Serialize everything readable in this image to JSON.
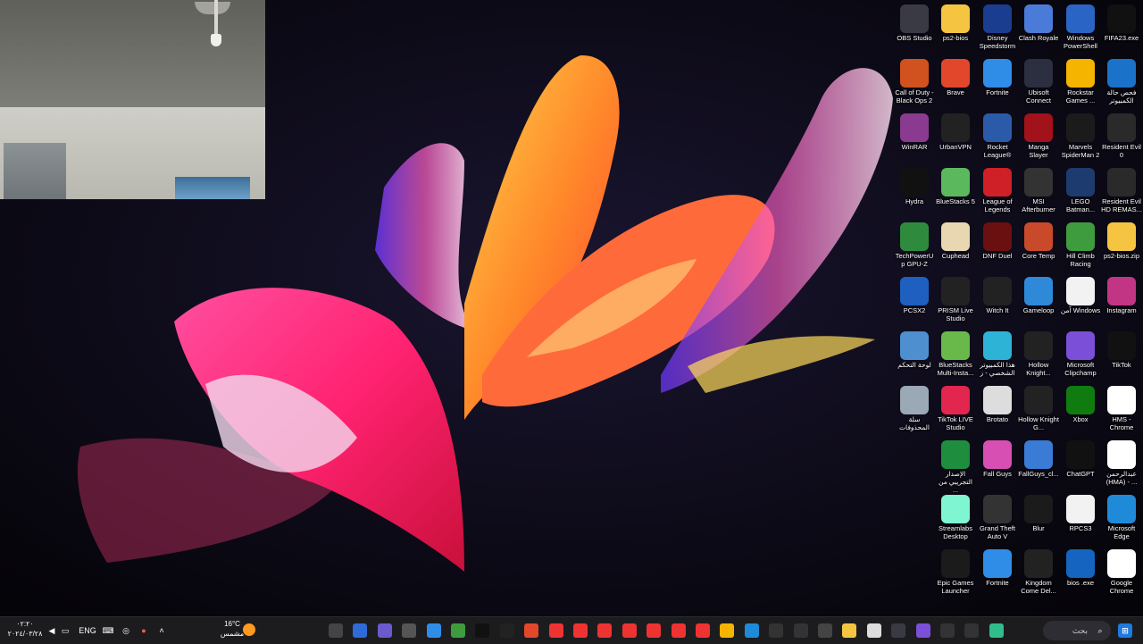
{
  "desktop_icons": [
    {
      "label": "OBS Studio",
      "icon": "obs-icon",
      "color": "#3a3a44"
    },
    {
      "label": "ps2-bios",
      "icon": "folder-icon",
      "color": "#f5c542"
    },
    {
      "label": "Disney Speedstorm",
      "icon": "disney-speedstorm-icon",
      "color": "#1b3d8f"
    },
    {
      "label": "Clash Royale",
      "icon": "clash-royale-icon",
      "color": "#4b7bd8"
    },
    {
      "label": "Windows PowerShell",
      "icon": "powershell-icon",
      "color": "#2a64c5"
    },
    {
      "label": "FIFA23.exe",
      "icon": "fifa-icon",
      "color": "#111111"
    },
    {
      "label": "Call of Duty - Black Ops 2",
      "icon": "cod-icon",
      "color": "#d1521f"
    },
    {
      "label": "Brave",
      "icon": "brave-icon",
      "color": "#e2472c"
    },
    {
      "label": "Fortnite",
      "icon": "fortnite-icon",
      "color": "#2f8de8"
    },
    {
      "label": "Ubisoft Connect",
      "icon": "ubisoft-icon",
      "color": "#2b2f3f"
    },
    {
      "label": "Rockstar Games ...",
      "icon": "rockstar-icon",
      "color": "#f4b400"
    },
    {
      "label": "فحص حالة الكمبيوتر",
      "icon": "pc-health-icon",
      "color": "#1a73c9"
    },
    {
      "label": "WinRAR",
      "icon": "winrar-icon",
      "color": "#8a3b8f"
    },
    {
      "label": "UrbanVPN",
      "icon": "urbanvpn-icon",
      "color": "#222"
    },
    {
      "label": "Rocket League®",
      "icon": "rocket-league-icon",
      "color": "#2b5ba8"
    },
    {
      "label": "Manga Slayer",
      "icon": "manga-slayer-icon",
      "color": "#a2121a"
    },
    {
      "label": "Marvels SpiderMan 2",
      "icon": "spiderman-icon",
      "color": "#1b1b1b"
    },
    {
      "label": "Resident Evil 0",
      "icon": "resident-evil-icon",
      "color": "#2a2a2a"
    },
    {
      "label": "Hydra",
      "icon": "hydra-icon",
      "color": "#111111"
    },
    {
      "label": "BlueStacks 5",
      "icon": "bluestacks-icon",
      "color": "#5cb85c"
    },
    {
      "label": "League of Legends",
      "icon": "lol-icon",
      "color": "#cf1f27"
    },
    {
      "label": "MSI Afterburner",
      "icon": "msi-afterburner-icon",
      "color": "#333"
    },
    {
      "label": "LEGO Batman...",
      "icon": "lego-batman-icon",
      "color": "#1d3b6e"
    },
    {
      "label": "Resident Evil HD REMAS...",
      "icon": "resident-evil-hd-icon",
      "color": "#2a2a2a"
    },
    {
      "label": "TechPowerUp GPU-Z",
      "icon": "gpuz-icon",
      "color": "#2e8b3e"
    },
    {
      "label": "Cuphead",
      "icon": "cuphead-icon",
      "color": "#e8d7b0"
    },
    {
      "label": "DNF Duel",
      "icon": "dnf-duel-icon",
      "color": "#6b1010"
    },
    {
      "label": "Core Temp",
      "icon": "core-temp-icon",
      "color": "#c84a2a"
    },
    {
      "label": "Hill Climb Racing",
      "icon": "hill-climb-icon",
      "color": "#3e9c3e"
    },
    {
      "label": "ps2-bios.zip",
      "icon": "zip-folder-icon",
      "color": "#f5c542"
    },
    {
      "label": "PCSX2",
      "icon": "pcsx2-icon",
      "color": "#1f5fbf"
    },
    {
      "label": "PRISM Live Studio",
      "icon": "prism-icon",
      "color": "#222"
    },
    {
      "label": "Witch It",
      "icon": "epic-games-icon",
      "color": "#222"
    },
    {
      "label": "Gameloop",
      "icon": "gameloop-icon",
      "color": "#2e8ad8"
    },
    {
      "label": "آمن Windows",
      "icon": "file-icon",
      "color": "#f2f2f2"
    },
    {
      "label": "Instagram",
      "icon": "instagram-icon",
      "color": "#c13584"
    },
    {
      "label": "لوحة التحكم",
      "icon": "control-panel-icon",
      "color": "#4e8fd0"
    },
    {
      "label": "BlueStacks Multi-Insta...",
      "icon": "bluestacks-multi-icon",
      "color": "#69b94a"
    },
    {
      "label": "هذا الكمبيوتر الشخصي - ز",
      "icon": "this-pc-icon",
      "color": "#2db3d6"
    },
    {
      "label": "Hollow Knight...",
      "icon": "hollow-knight-icon",
      "color": "#222"
    },
    {
      "label": "Microsoft Clipchamp",
      "icon": "clipchamp-icon",
      "color": "#7b4fd8"
    },
    {
      "label": "TikTok",
      "icon": "tiktok-icon",
      "color": "#111"
    },
    {
      "label": "سلة المحذوفات",
      "icon": "recycle-bin-icon",
      "color": "#9aa9b5"
    },
    {
      "label": "TikTok LIVE Studio",
      "icon": "tiktok-live-icon",
      "color": "#e2264d"
    },
    {
      "label": "Brotato",
      "icon": "brotato-icon",
      "color": "#dddddd"
    },
    {
      "label": "Hollow Knight G...",
      "icon": "hollow-knight-g-icon",
      "color": "#222"
    },
    {
      "label": "Xbox",
      "icon": "xbox-icon",
      "color": "#107c10"
    },
    {
      "label": "HMS - Chrome",
      "icon": "chrome-icon",
      "color": "#ffffff"
    },
    {
      "label": "الإصدار التجريبي من ...",
      "icon": "play-games-beta-icon",
      "color": "#1e8e3e"
    },
    {
      "label": "Fall Guys",
      "icon": "fall-guys-icon",
      "color": "#d84fb3"
    },
    {
      "label": "FallGuys_cl...",
      "icon": "fall-guys-client-icon",
      "color": "#3a7bd5"
    },
    {
      "label": "ChatGPT",
      "icon": "chatgpt-icon",
      "color": "#111"
    },
    {
      "label": "عبدالرحمن (HMA) - ...",
      "icon": "chrome-icon",
      "color": "#ffffff"
    },
    {
      "label": "Streamlabs Desktop",
      "icon": "streamlabs-icon",
      "color": "#80f5d2"
    },
    {
      "label": "Grand Theft Auto V",
      "icon": "gta-icon",
      "color": "#333"
    },
    {
      "label": "Blur",
      "icon": "blur-icon",
      "color": "#1b1b1b"
    },
    {
      "label": "RPCS3",
      "icon": "file-icon",
      "color": "#f2f2f2"
    },
    {
      "label": "Microsoft Edge",
      "icon": "edge-icon",
      "color": "#1f8bd8"
    },
    {
      "label": "Epic Games Launcher",
      "icon": "epic-games-launcher-icon",
      "color": "#1b1b1b"
    },
    {
      "label": "Fortnite",
      "icon": "fortnite-icon",
      "color": "#2f8de8"
    },
    {
      "label": "Kingdom Come Del...",
      "icon": "kingdom-come-icon",
      "color": "#222"
    },
    {
      "label": "bios .exe",
      "icon": "exe-icon",
      "color": "#1565c0"
    },
    {
      "label": "Google Chrome",
      "icon": "chrome-icon",
      "color": "#ffffff"
    }
  ],
  "taskbar": {
    "clock_time": "٠٢:٢٠",
    "clock_date": "٢٠٢٤/٠٣/٢٨",
    "language": "ENG",
    "weather_temp": "16°C",
    "weather_desc": "مشمس",
    "search_placeholder": "بحث",
    "pinned_apps": [
      {
        "icon": "spider-app-icon",
        "color": "#444"
      },
      {
        "icon": "globe-icon",
        "color": "#2e6bd8"
      },
      {
        "icon": "gamepad-icon",
        "color": "#6a5acd"
      },
      {
        "icon": "settings-icon",
        "color": "#555"
      },
      {
        "icon": "fortnite-icon",
        "color": "#2f8de8"
      },
      {
        "icon": "hill-climb-icon",
        "color": "#3e9c3e"
      },
      {
        "icon": "tiktok-icon",
        "color": "#111"
      },
      {
        "icon": "urbanvpn-icon",
        "color": "#222"
      },
      {
        "icon": "brave-icon",
        "color": "#e2472c"
      },
      {
        "icon": "chrome-icon",
        "color": "#e33"
      },
      {
        "icon": "chrome-icon",
        "color": "#e33"
      },
      {
        "icon": "chrome-icon",
        "color": "#e33"
      },
      {
        "icon": "chrome-icon",
        "color": "#e33"
      },
      {
        "icon": "chrome-icon",
        "color": "#e33"
      },
      {
        "icon": "chrome-icon",
        "color": "#e33"
      },
      {
        "icon": "chrome-icon",
        "color": "#e33"
      },
      {
        "icon": "rockstar-icon",
        "color": "#f4b400"
      },
      {
        "icon": "edge-icon",
        "color": "#1f8bd8"
      },
      {
        "icon": "media-player-icon",
        "color": "#333"
      },
      {
        "icon": "task-manager-icon",
        "color": "#333"
      },
      {
        "icon": "calculator-icon",
        "color": "#444"
      },
      {
        "icon": "file-explorer-icon",
        "color": "#f5c542"
      },
      {
        "icon": "notepad-icon",
        "color": "#ddd"
      },
      {
        "icon": "obs-taskbar-icon",
        "color": "#3a3a44"
      },
      {
        "icon": "clipchamp-icon",
        "color": "#7b4fd8"
      },
      {
        "icon": "record-icon",
        "color": "#333"
      },
      {
        "icon": "xbox-icon",
        "color": "#333"
      },
      {
        "icon": "streamlabs-icon",
        "color": "#2ebd8b"
      }
    ]
  }
}
